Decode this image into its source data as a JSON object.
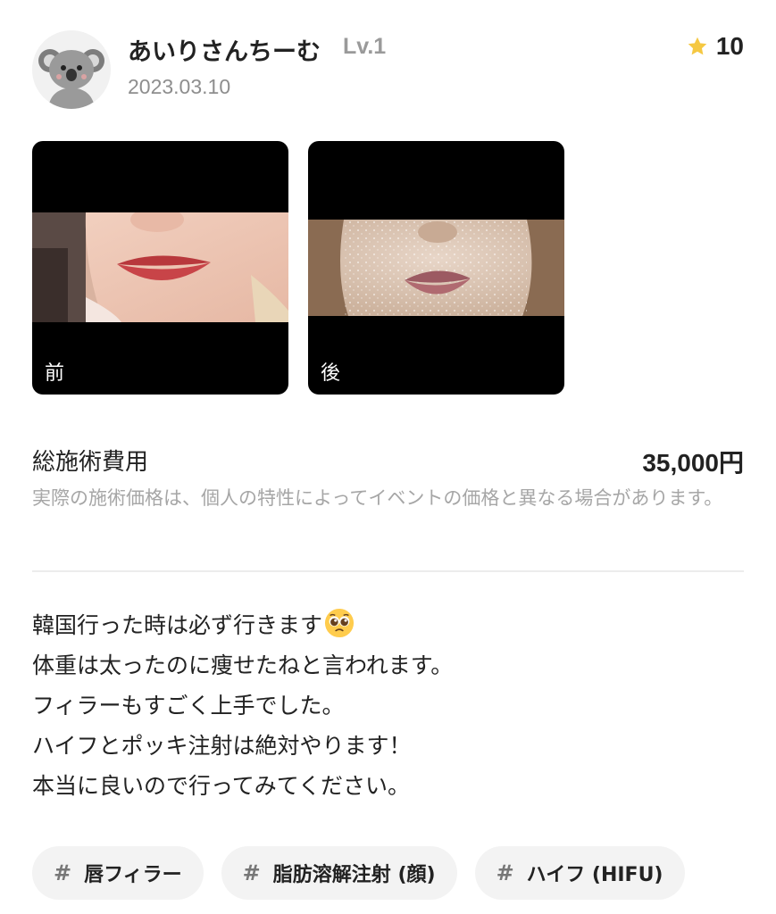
{
  "profile": {
    "username": "あいりさんちーむ",
    "level": "Lv.1",
    "date": "2023.03.10",
    "avatar_icon": "koala-icon",
    "points": "10",
    "points_icon": "star-icon",
    "points_color": "#f5c842"
  },
  "photos": {
    "before_label": "前",
    "after_label": "後"
  },
  "cost": {
    "label": "総施術費用",
    "value": "35,000円",
    "note": "実際の施術価格は、個人の特性によってイベントの価格と異なる場合があります。"
  },
  "review": {
    "lines": [
      "韓国行った時は必ず行きます",
      "体重は太ったのに痩せたねと言われます。",
      "フィラーもすごく上手でした。",
      "ハイフとポッキ注射は絶対やります！",
      "本当に良いので行ってみてください。"
    ],
    "emoji": "pleading-face-emoji"
  },
  "tags": [
    {
      "hash": "#",
      "label": "唇フィラー"
    },
    {
      "hash": "#",
      "label": "脂肪溶解注射 (顔)"
    },
    {
      "hash": "#",
      "label": "ハイフ (HIFU)"
    }
  ]
}
